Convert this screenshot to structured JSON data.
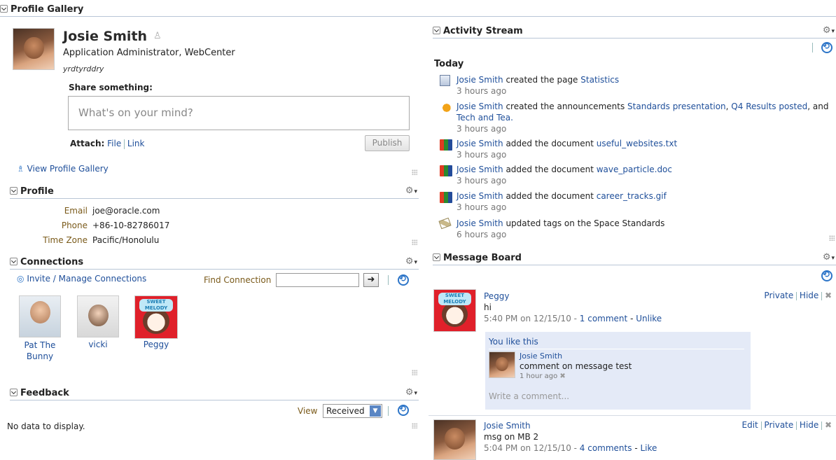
{
  "top_header": {
    "title": "Profile Gallery"
  },
  "profile": {
    "name": "Josie Smith",
    "title": "Application Administrator, WebCenter",
    "status": "yrdtyrddry",
    "share_label": "Share something:",
    "share_placeholder": "What's on your mind?",
    "attach_label": "Attach:",
    "attach_file": "File",
    "attach_link": "Link",
    "publish_label": "Publish",
    "view_gallery": "View Profile Gallery"
  },
  "profile_section": {
    "title": "Profile",
    "rows": [
      {
        "label": "Email",
        "value": "joe@oracle.com"
      },
      {
        "label": "Phone",
        "value": "+86-10-82786017"
      },
      {
        "label": "Time Zone",
        "value": "Pacific/Honolulu"
      }
    ]
  },
  "connections": {
    "title": "Connections",
    "invite_label": "Invite / Manage Connections",
    "find_label": "Find Connection",
    "people": [
      {
        "name": "Pat The Bunny"
      },
      {
        "name": "vicki"
      },
      {
        "name": "Peggy"
      }
    ]
  },
  "feedback": {
    "title": "Feedback",
    "view_label": "View",
    "view_selected": "Received",
    "empty": "No data to display."
  },
  "activity": {
    "title": "Activity Stream",
    "day": "Today",
    "items": [
      {
        "icon": "page-icon",
        "actor": "Josie Smith",
        "text": " created the page ",
        "obj": "Statistics",
        "time": "3 hours ago"
      },
      {
        "icon": "announcement-icon",
        "actor": "Josie Smith",
        "text": " created the announcements ",
        "obj": "Standards presentation",
        "sep1": ", ",
        "obj2": "Q4 Results posted",
        "sep2": ", and",
        "obj3": "Tech and Tea.",
        "time": "3 hours ago"
      },
      {
        "icon": "document-icon",
        "actor": "Josie Smith",
        "text": " added the document ",
        "obj": "useful_websites.txt",
        "time": "3 hours ago"
      },
      {
        "icon": "document-icon",
        "actor": "Josie Smith",
        "text": " added the document ",
        "obj": "wave_particle.doc",
        "time": "3 hours ago"
      },
      {
        "icon": "document-icon",
        "actor": "Josie Smith",
        "text": " added the document ",
        "obj": "career_tracks.gif",
        "time": "3 hours ago"
      },
      {
        "icon": "tag-icon",
        "actor": "Josie Smith",
        "text": " updated tags on the Space Standards",
        "time": "6 hours ago"
      }
    ]
  },
  "board": {
    "title": "Message Board",
    "messages": [
      {
        "author": "Peggy",
        "body": "hi",
        "meta": "5:40 PM on 12/15/10 - ",
        "comments": "1 comment",
        "dash": " - ",
        "like": "Unlike",
        "actions": [
          "Private",
          "Hide"
        ],
        "you_like": "You like this",
        "comment": {
          "author": "Josie Smith",
          "text": "comment on message test",
          "time": "1 hour ago"
        },
        "comment_placeholder": "Write a comment..."
      },
      {
        "author": "Josie Smith",
        "body": "msg on MB 2",
        "meta": "5:04 PM on 12/15/10 - ",
        "comments": "4 comments",
        "dash": " - ",
        "like": "Like",
        "actions": [
          "Edit",
          "Private",
          "Hide"
        ]
      }
    ]
  }
}
